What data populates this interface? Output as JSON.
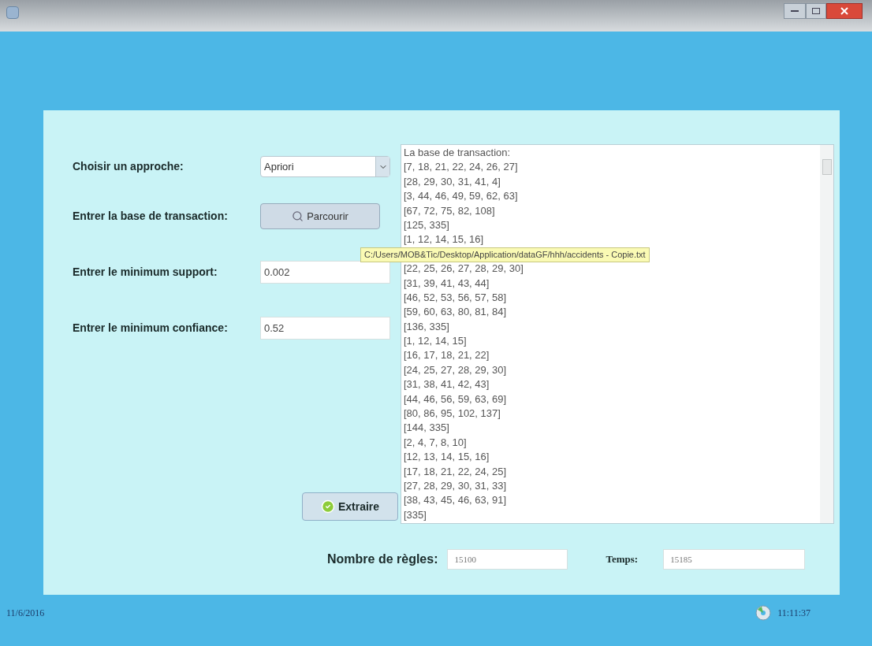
{
  "form": {
    "fields": [
      {
        "kind": "select",
        "label": "Choisir un approche:",
        "value": "Apriori"
      },
      {
        "kind": "browse",
        "label": "Entrer la base de transaction:",
        "button": "Parcourir"
      },
      {
        "kind": "input",
        "label": "Entrer le minimum support:",
        "value": "0.002"
      },
      {
        "kind": "input",
        "label": "Entrer le minimum confiance:",
        "value": "0.52"
      }
    ],
    "extract_button": "Extraire"
  },
  "transactions": {
    "rows_above": [
      "La base de transaction:",
      "[7, 18, 21, 22, 24, 26, 27]",
      "[28, 29, 30, 31, 41, 4]",
      "[3, 44, 46, 49, 59, 62, 63]",
      "[67, 72, 75, 82, 108]",
      "[125, 335]",
      "[1, 12, 14, 15, 16]"
    ],
    "tooltip": "C:/Users/MOB&Tic/Desktop/Application/dataGF/hhh/accidents - Copie.txt",
    "rows_below": [
      "[22, 25, 26, 27, 28, 29, 30]",
      "[31, 39, 41, 43, 44]",
      "[46, 52, 53, 56, 57, 58]",
      "[59, 60, 63, 80, 81, 84]",
      "[136, 335]",
      "[1, 12, 14, 15]",
      "[16, 17, 18, 21, 22]",
      "[24, 25, 27, 28, 29, 30]",
      "[31, 38, 41, 42, 43]",
      "[44, 46, 56, 59, 63, 69]",
      "[80, 86, 95, 102, 137]",
      "[144, 335]",
      "[2, 4, 7, 8, 10]",
      "[12, 13, 14, 15, 16]",
      "[17, 18, 21, 22, 24, 25]",
      "[27, 28, 29, 30, 31, 33]",
      "[38, 43, 45, 46, 63, 91]",
      "[335]"
    ]
  },
  "results": {
    "rules_label": "Nombre de règles:",
    "rules_value": "15100",
    "time_label": "Temps:",
    "time_value": "15185"
  },
  "status_bar": {
    "date": "11/6/2016",
    "time": "11:11:37"
  }
}
